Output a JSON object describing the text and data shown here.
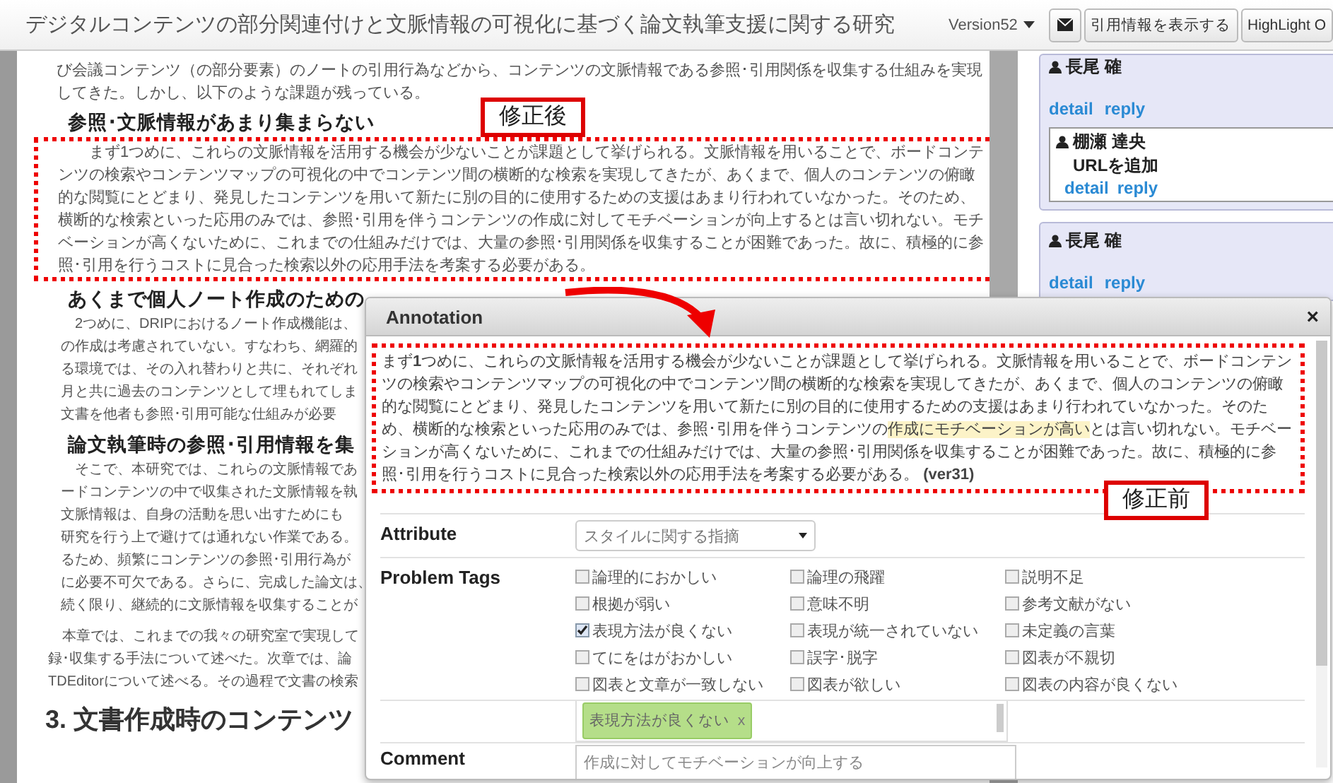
{
  "header": {
    "title": "デジタルコンテンツの部分関連付けと文脈情報の可視化に基づく論文執筆支援に関する研究",
    "version": "Version52",
    "buttons": [
      {
        "kind": "mail"
      },
      {
        "kind": "text",
        "label": "引用情報を表示する"
      },
      {
        "kind": "text",
        "label": "HighLight O"
      }
    ]
  },
  "document": {
    "blocks": [
      {
        "kind": "p",
        "text": "び会議コンテンツ（の部分要素）のノートの引用行為などから、コンテンツの文脈情報である参照･引用関係を収集する仕組みを実現してきた。しかし、以下のような課題が残っている。"
      },
      {
        "kind": "h",
        "text": "参照･文脈情報があまり集まらない"
      },
      {
        "kind": "framed",
        "text": "まず1つめに、これらの文脈情報を活用する機会が少ないことが課題として挙げられる。文脈情報を用いることで、ボードコンテンツの検索やコンテンツマップの可視化の中でコンテンツ間の横断的な検索を実現してきたが、あくまで、個人のコンテンツの俯瞰的な閲覧にとどまり、発見したコンテンツを用いて新たに別の目的に使用するための支援はあまり行われていなかった。そのため、横断的な検索といった応用のみでは、参照･引用を伴うコンテンツの作成に対してモチベーションが向上するとは言い切れない。モチベーションが高くないために、これまでの仕組みだけでは、大量の参照･引用関係を収集することが困難であった。故に、積極的に参照･引用を行うコストに見合った検索以外の応用手法を考案する必要がある。"
      },
      {
        "kind": "h",
        "text": "あくまで個人ノート作成のための"
      },
      {
        "kind": "lead",
        "text": "2つめに、DRIPにおけるノート作成機能は、"
      },
      {
        "kind": "line",
        "text": "の作成は考慮されていない。すなわち、網羅的"
      },
      {
        "kind": "line",
        "text": "る環境では、その入れ替わりと共に、それぞれ"
      },
      {
        "kind": "line",
        "text": "月と共に過去のコンテンツとして埋もれてしま"
      },
      {
        "kind": "line",
        "text": "文書を他者も参照･引用可能な仕組みが必要"
      },
      {
        "kind": "h",
        "text": "論文執筆時の参照･引用情報を集"
      },
      {
        "kind": "lead",
        "text": "そこで、本研究では、これらの文脈情報であ"
      },
      {
        "kind": "line",
        "text": "ードコンテンツの中で収集された文脈情報を執"
      },
      {
        "kind": "line",
        "text": "文脈情報は、自身の活動を思い出すためにも"
      },
      {
        "kind": "line",
        "text": "研究を行う上で避けては通れない作業である。"
      },
      {
        "kind": "line",
        "text": "るため、頻繁にコンテンツの参照･引用行為が"
      },
      {
        "kind": "line",
        "text": "に必要不可欠である。さらに、完成した論文は、"
      },
      {
        "kind": "line",
        "text": "続く限り、継続的に文脈情報を収集することが"
      },
      {
        "kind": "outlead",
        "text": "本章では、これまでの我々の研究室で実現して"
      },
      {
        "kind": "outline",
        "text": "録･収集する手法について述べた。次章では、論"
      },
      {
        "kind": "outline",
        "text": "TDEditorについて述べる。その過程で文書の検索"
      },
      {
        "kind": "h2",
        "text": "3. 文書作成時のコンテンツ"
      }
    ]
  },
  "comments": [
    {
      "author": "長尾 確",
      "links": [
        "detail",
        "reply"
      ],
      "replies": [
        {
          "author": "棚瀬 達央",
          "body": "URLを追加",
          "links": [
            "detail",
            "reply"
          ]
        }
      ]
    },
    {
      "author": "長尾 確",
      "links": [
        "detail",
        "reply"
      ]
    }
  ],
  "callouts": [
    {
      "label": "修正後"
    },
    {
      "label": "修正前"
    }
  ],
  "dialog": {
    "title": "Annotation",
    "close": "×",
    "quote": {
      "before": "まず**1**つめに、これらの文脈情報を活用する機会が少ないことが課題として挙げられる。文脈情報を用いることで、ボードコンテンツの検索やコンテンツマップの可視化の中でコンテンツ間の横断的な検索を実現してきたが、あくまで、個人のコンテンツの俯瞰的な閲覧にとどまり、発見したコンテンツを用いて新たに別の目的に使用するための支援はあまり行われていなかった。そのため、横断的な検索といった応用のみでは、参照･引用を伴うコンテンツの",
      "highlight": "作成にモチベーションが高い",
      "after": "とは言い切れない。モチベーションが高くないために、これまでの仕組みだけでは、大量の参照･引用関係を収集することが困難であった。故に、積極的に参照･引用を行うコストに見合った検索以外の応用手法を考案する必要がある。",
      "version": "(ver31)"
    },
    "attribute": {
      "label": "Attribute",
      "value": "スタイルに関する指摘"
    },
    "tags_label": "Problem Tags",
    "tags": [
      {
        "label": "論理的におかしい",
        "checked": false
      },
      {
        "label": "論理の飛躍",
        "checked": false
      },
      {
        "label": "説明不足",
        "checked": false
      },
      {
        "label": "根拠が弱い",
        "checked": false
      },
      {
        "label": "意味不明",
        "checked": false
      },
      {
        "label": "参考文献がない",
        "checked": false
      },
      {
        "label": "表現方法が良くない",
        "checked": true
      },
      {
        "label": "表現が統一されていない",
        "checked": false
      },
      {
        "label": "未定義の言葉",
        "checked": false
      },
      {
        "label": "てにをはがおかしい",
        "checked": false
      },
      {
        "label": "誤字･脱字",
        "checked": false
      },
      {
        "label": "図表が不親切",
        "checked": false
      },
      {
        "label": "図表と文章が一致しない",
        "checked": false
      },
      {
        "label": "図表が欲しい",
        "checked": false
      },
      {
        "label": "図表の内容が良くない",
        "checked": false
      }
    ],
    "chips": [
      {
        "label": "表現方法が良くない",
        "remove": "x"
      }
    ],
    "comment": {
      "label": "Comment",
      "placeholder": "作成に対してモチベーションが向上する"
    }
  }
}
